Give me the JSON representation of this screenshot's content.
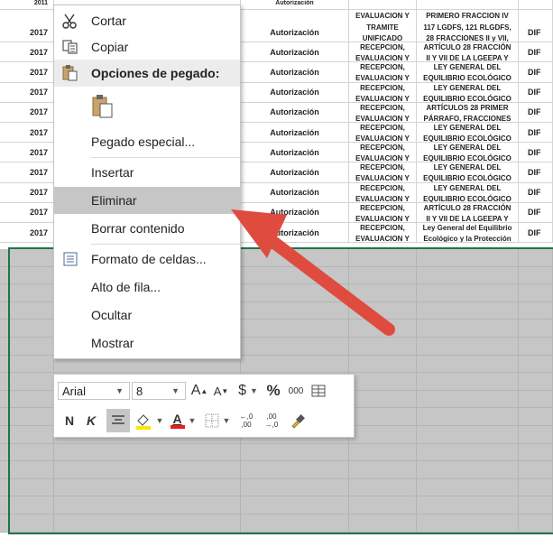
{
  "sheet": {
    "top_partial": {
      "year": "2011",
      "b": "",
      "auth": "Autorización",
      "ev": "EVALUACION Y",
      "ley": "PRIMERO FRACCION IV"
    },
    "rows": [
      {
        "year": "2017",
        "auth": "Autorización",
        "ev1": "TRAMITE",
        "ev2": "UNIFICADO",
        "ley1": "117 LGDFS, 121 RLGDFS,",
        "ley2": "28 FRACCIONES II y VII,",
        "dif": "DIF"
      },
      {
        "year": "2017",
        "auth": "Autorización",
        "ev1": "RECEPCION,",
        "ev2": "EVALUACION Y",
        "ley1": "ARTÍCULO 28 FRACCIÓN",
        "ley2": "II Y VII DE LA LGEEPA Y",
        "dif": "DIF"
      },
      {
        "year": "2017",
        "auth": "Autorización",
        "ev1": "RECEPCION,",
        "ev2": "EVALUACION Y",
        "ley1": "LEY GENERAL DEL",
        "ley2": "EQUILIBRIO ECOLÓGICO",
        "dif": "DIF"
      },
      {
        "year": "2017",
        "auth": "Autorización",
        "ev1": "RECEPCION,",
        "ev2": "EVALUACION Y",
        "ley1": "LEY GENERAL DEL",
        "ley2": "EQUILIBRIO ECOLÓGICO",
        "dif": "DIF"
      },
      {
        "year": "2017",
        "auth": "Autorización",
        "ev1": "RECEPCION,",
        "ev2": "EVALUACION Y",
        "ley1": "ARTÍCULOS 28 PRIMER",
        "ley2": "PÁRRAFO, FRACCIONES",
        "dif": "DIF"
      },
      {
        "year": "2017",
        "auth": "Autorización",
        "ev1": "RECEPCION,",
        "ev2": "EVALUACION Y",
        "ley1": "LEY GENERAL DEL",
        "ley2": "EQUILIBRIO ECOLÓGICO",
        "dif": "DIF"
      },
      {
        "year": "2017",
        "auth": "Autorización",
        "ev1": "RECEPCION,",
        "ev2": "EVALUACION Y",
        "ley1": "LEY GENERAL DEL",
        "ley2": "EQUILIBRIO ECOLÓGICO",
        "dif": "DIF"
      },
      {
        "year": "2017",
        "auth": "Autorización",
        "ev1": "RECEPCION,",
        "ev2": "EVALUACION Y",
        "ley1": "LEY GENERAL DEL",
        "ley2": "EQUILIBRIO ECOLÓGICO",
        "dif": "DIF"
      },
      {
        "year": "2017",
        "auth": "Autorización",
        "ev1": "RECEPCION,",
        "ev2": "EVALUACION Y",
        "ley1": "LEY GENERAL DEL",
        "ley2": "EQUILIBRIO ECOLÓGICO",
        "dif": "DIF"
      },
      {
        "year": "2017",
        "auth": "Autorización",
        "ev1": "RECEPCION,",
        "ev2": "EVALUACION Y",
        "ley1": "ARTÍCULO 28 FRACCIÓN",
        "ley2": "II Y VII DE LA LGEEPA Y",
        "dif": "DIF"
      },
      {
        "year": "2017",
        "auth": "Autorización",
        "ev1": "RECEPCION,",
        "ev2": "EVALUACION Y",
        "ley1": "Ley General del Equilibrio",
        "ley2": "Ecológico y la Protección",
        "dif": "DIF"
      }
    ]
  },
  "menu": {
    "cut": {
      "label": "Cortar",
      "icon": "scissors-icon"
    },
    "copy": {
      "label": "Copiar",
      "icon": "copy-icon"
    },
    "paste_header": {
      "label": "Opciones de pegado:",
      "icon": "paste-icon"
    },
    "paste_special": {
      "label": "Pegado especial..."
    },
    "insert": {
      "label": "Insertar"
    },
    "delete": {
      "label": "Eliminar"
    },
    "clear": {
      "label": "Borrar contenido"
    },
    "format": {
      "label": "Formato de celdas...",
      "icon": "format-cells-icon"
    },
    "row_height": {
      "label": "Alto de fila..."
    },
    "hide": {
      "label": "Ocultar"
    },
    "unhide": {
      "label": "Mostrar"
    }
  },
  "mini_toolbar": {
    "font": "Arial",
    "size": "8",
    "grow_font": "A",
    "shrink_font": "A",
    "currency": "$",
    "percent": "%",
    "thousands": "000",
    "bold": "N",
    "italic": "K",
    "font_color": "A",
    "inc_decimal": "←,0 ,00",
    "dec_decimal": ",00 →,0"
  },
  "colors": {
    "accent_green": "#217346",
    "arrow_red": "#e04b40",
    "highlight": "#c6c6c6"
  }
}
